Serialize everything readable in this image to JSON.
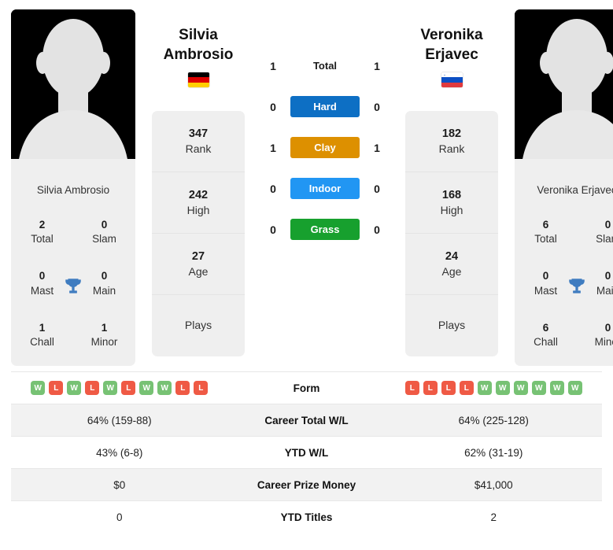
{
  "players": {
    "left": {
      "name": "Silvia Ambrosio",
      "name_line1": "Silvia",
      "name_line2": "Ambrosio",
      "country": "germany",
      "flag_colors": [
        "#000000",
        "#dd0000",
        "#ffce00"
      ],
      "photo_caption": "Silvia Ambrosio",
      "rank": "347",
      "rank_label": "Rank",
      "high": "242",
      "high_label": "High",
      "age": "27",
      "age_label": "Age",
      "plays": "",
      "plays_label": "Plays",
      "titles": [
        {
          "value": "2",
          "label": "Total"
        },
        {
          "value": "0",
          "label": "Slam"
        },
        {
          "value": "0",
          "label": "Mast"
        },
        {
          "value": "0",
          "label": "Main"
        },
        {
          "value": "1",
          "label": "Chall"
        },
        {
          "value": "1",
          "label": "Minor"
        }
      ],
      "form": [
        "W",
        "L",
        "W",
        "L",
        "W",
        "L",
        "W",
        "W",
        "L",
        "L"
      ],
      "career_wl": "64% (159-88)",
      "ytd_wl": "43% (6-8)",
      "career_prize": "$0",
      "ytd_titles": "0"
    },
    "right": {
      "name": "Veronika Erjavec",
      "name_line1": "Veronika",
      "name_line2": "Erjavec",
      "country": "slovenia",
      "flag_colors": [
        "#ffffff",
        "#0c4fc4",
        "#e03a3e"
      ],
      "photo_caption": "Veronika Erjavec",
      "rank": "182",
      "rank_label": "Rank",
      "high": "168",
      "high_label": "High",
      "age": "24",
      "age_label": "Age",
      "plays": "",
      "plays_label": "Plays",
      "titles": [
        {
          "value": "6",
          "label": "Total"
        },
        {
          "value": "0",
          "label": "Slam"
        },
        {
          "value": "0",
          "label": "Mast"
        },
        {
          "value": "0",
          "label": "Main"
        },
        {
          "value": "6",
          "label": "Chall"
        },
        {
          "value": "0",
          "label": "Minor"
        }
      ],
      "form": [
        "L",
        "L",
        "L",
        "L",
        "W",
        "W",
        "W",
        "W",
        "W",
        "W"
      ],
      "career_wl": "64% (225-128)",
      "ytd_wl": "62% (31-19)",
      "career_prize": "$41,000",
      "ytd_titles": "2"
    }
  },
  "head_to_head": [
    {
      "surface": "Total",
      "left": "1",
      "right": "1",
      "color": "",
      "is_total": true
    },
    {
      "surface": "Hard",
      "left": "0",
      "right": "0",
      "color": "#0d6fc4",
      "is_total": false
    },
    {
      "surface": "Clay",
      "left": "1",
      "right": "1",
      "color": "#dd9000",
      "is_total": false
    },
    {
      "surface": "Indoor",
      "left": "0",
      "right": "0",
      "color": "#2196f3",
      "is_total": false
    },
    {
      "surface": "Grass",
      "left": "0",
      "right": "0",
      "color": "#17a02e",
      "is_total": false
    }
  ],
  "table": {
    "rows": [
      {
        "label": "Form",
        "left": "",
        "right": "",
        "type": "form"
      },
      {
        "label": "Career Total W/L",
        "left": "64% (159-88)",
        "right": "64% (225-128)",
        "type": "text"
      },
      {
        "label": "YTD W/L",
        "left": "43% (6-8)",
        "right": "62% (31-19)",
        "type": "text"
      },
      {
        "label": "Career Prize Money",
        "left": "$0",
        "right": "$41,000",
        "type": "text"
      },
      {
        "label": "YTD Titles",
        "left": "0",
        "right": "2",
        "type": "text"
      }
    ]
  },
  "colors": {
    "win": "#77c274",
    "loss": "#ef5a45",
    "card_bg": "#efefef",
    "row_alt": "#f2f2f2"
  }
}
